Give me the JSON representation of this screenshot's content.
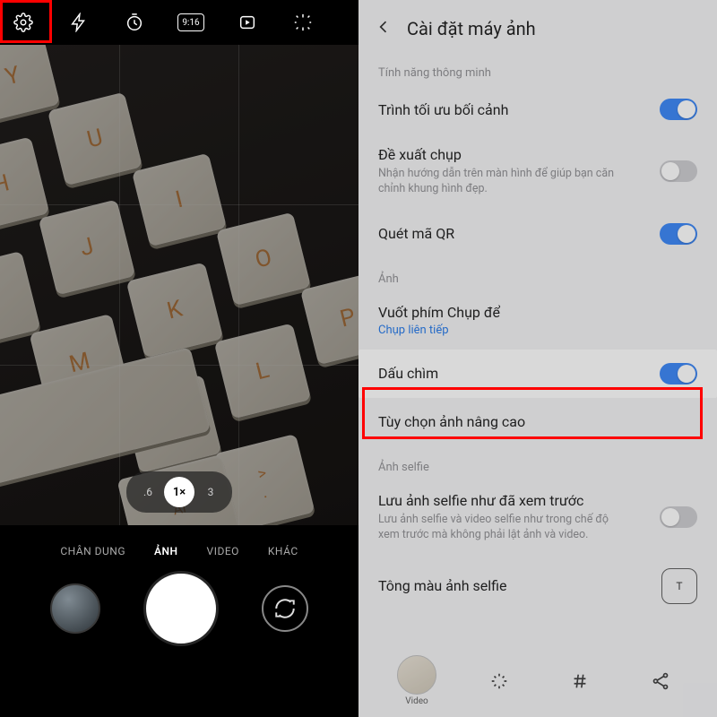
{
  "camera": {
    "topbar": {
      "ratio_label": "9:16"
    },
    "zoom": {
      "opt1": ".6",
      "sel": "1×",
      "opt2": "3"
    },
    "modes": {
      "m1": "CHÂN DUNG",
      "m2": "ẢNH",
      "m3": "VIDEO",
      "m4": "KHÁC"
    }
  },
  "settings": {
    "title": "Cài đặt máy ảnh",
    "section1": "Tính năng thông minh",
    "row_scene": {
      "title": "Trình tối ưu bối cảnh"
    },
    "row_suggest": {
      "title": "Đề xuất chụp",
      "sub": "Nhận hướng dẫn trên màn hình để giúp bạn căn chỉnh khung hình đẹp."
    },
    "row_qr": {
      "title": "Quét mã QR"
    },
    "section2": "Ảnh",
    "row_swipe": {
      "title": "Vuốt phím Chụp để",
      "sub": "Chụp liên tiếp"
    },
    "row_watermark": {
      "title": "Dấu chìm"
    },
    "row_adv": {
      "title": "Tùy chọn ảnh nâng cao"
    },
    "section3": "Ảnh selfie",
    "row_selfie": {
      "title": "Lưu ảnh selfie như đã xem trước",
      "sub": "Lưu ảnh selfie và video selfie như trong chế độ xem trước mà không phải lật ảnh và video."
    },
    "row_tone": {
      "title": "Tông màu ảnh selfie"
    },
    "bottom": {
      "video_label": "Video",
      "scan_label": "T"
    }
  }
}
